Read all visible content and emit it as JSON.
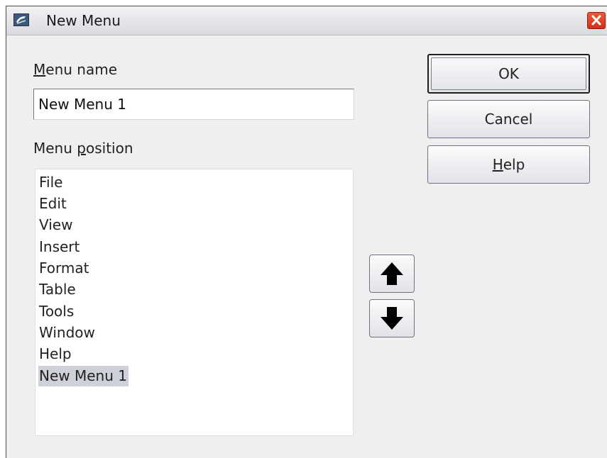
{
  "window": {
    "title": "New Menu"
  },
  "menu_name": {
    "label_mnemonic": "M",
    "label_rest": "enu name",
    "value": "New Menu 1"
  },
  "menu_position": {
    "label_pre": "Menu ",
    "label_mnemonic": "p",
    "label_rest": "osition",
    "items": [
      {
        "label": "File"
      },
      {
        "label": "Edit"
      },
      {
        "label": "View"
      },
      {
        "label": "Insert"
      },
      {
        "label": "Format"
      },
      {
        "label": "Table"
      },
      {
        "label": "Tools"
      },
      {
        "label": "Window"
      },
      {
        "label": "Help"
      },
      {
        "label": "New Menu 1"
      }
    ],
    "selected_index": 9
  },
  "buttons": {
    "ok": "OK",
    "cancel": "Cancel",
    "help_mnemonic": "H",
    "help_rest": "elp"
  },
  "icons": {
    "app": "app-icon",
    "close": "close-icon",
    "move_up": "arrow-up-icon",
    "move_down": "arrow-down-icon"
  },
  "colors": {
    "close_button": "#e0432a",
    "selection": "#cfd1d8"
  }
}
